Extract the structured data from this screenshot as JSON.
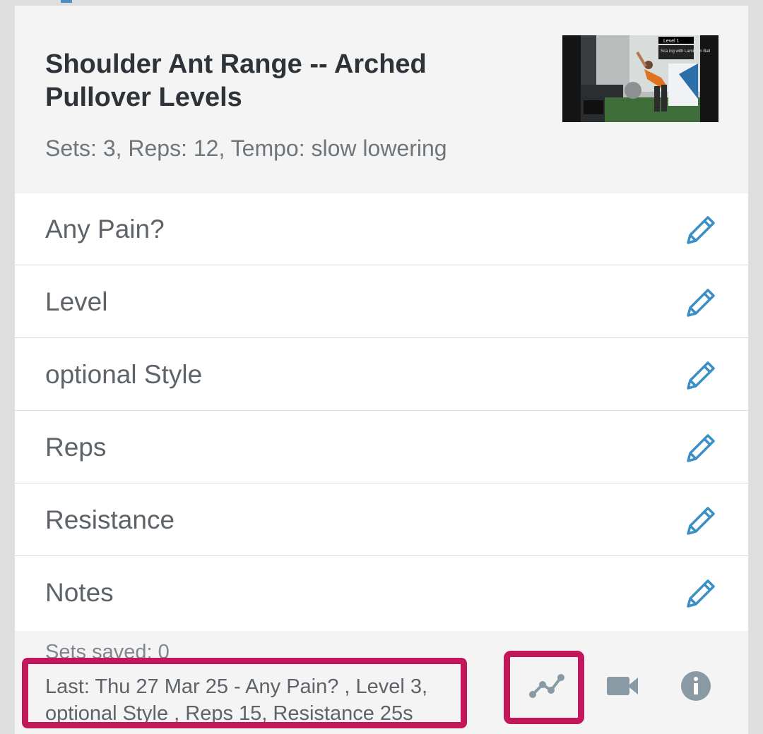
{
  "exercise": {
    "title": "Shoulder Ant Range -- Arched Pullover Levels",
    "prescription": "Sets: 3, Reps: 12, Tempo: slow lowering",
    "thumbnail_caption": "Level 1",
    "thumbnail_text": "Sca ing with Lamin an Ball"
  },
  "fields": [
    {
      "label": "Any Pain?",
      "icon": "pencil-icon"
    },
    {
      "label": "Level",
      "icon": "pencil-icon"
    },
    {
      "label": "optional Style",
      "icon": "pencil-icon"
    },
    {
      "label": "Reps",
      "icon": "pencil-icon"
    },
    {
      "label": "Resistance",
      "icon": "pencil-icon"
    },
    {
      "label": "Notes",
      "icon": "pencil-icon"
    }
  ],
  "footer": {
    "sets_saved": "Sets saved: 0",
    "last_line1": "Last: Thu 27 Mar 25 - Any Pain? , Level 3,",
    "last_line2": "optional Style , Reps 15, Resistance 25s",
    "actions": [
      {
        "name": "chart-icon"
      },
      {
        "name": "video-camera-icon"
      },
      {
        "name": "info-icon"
      }
    ]
  },
  "colors": {
    "accent": "#3a8fc6",
    "highlight": "#c2185b",
    "text_dark": "#2d3338",
    "text_muted": "#6e757b",
    "icon_gray": "#8a9aa4"
  }
}
